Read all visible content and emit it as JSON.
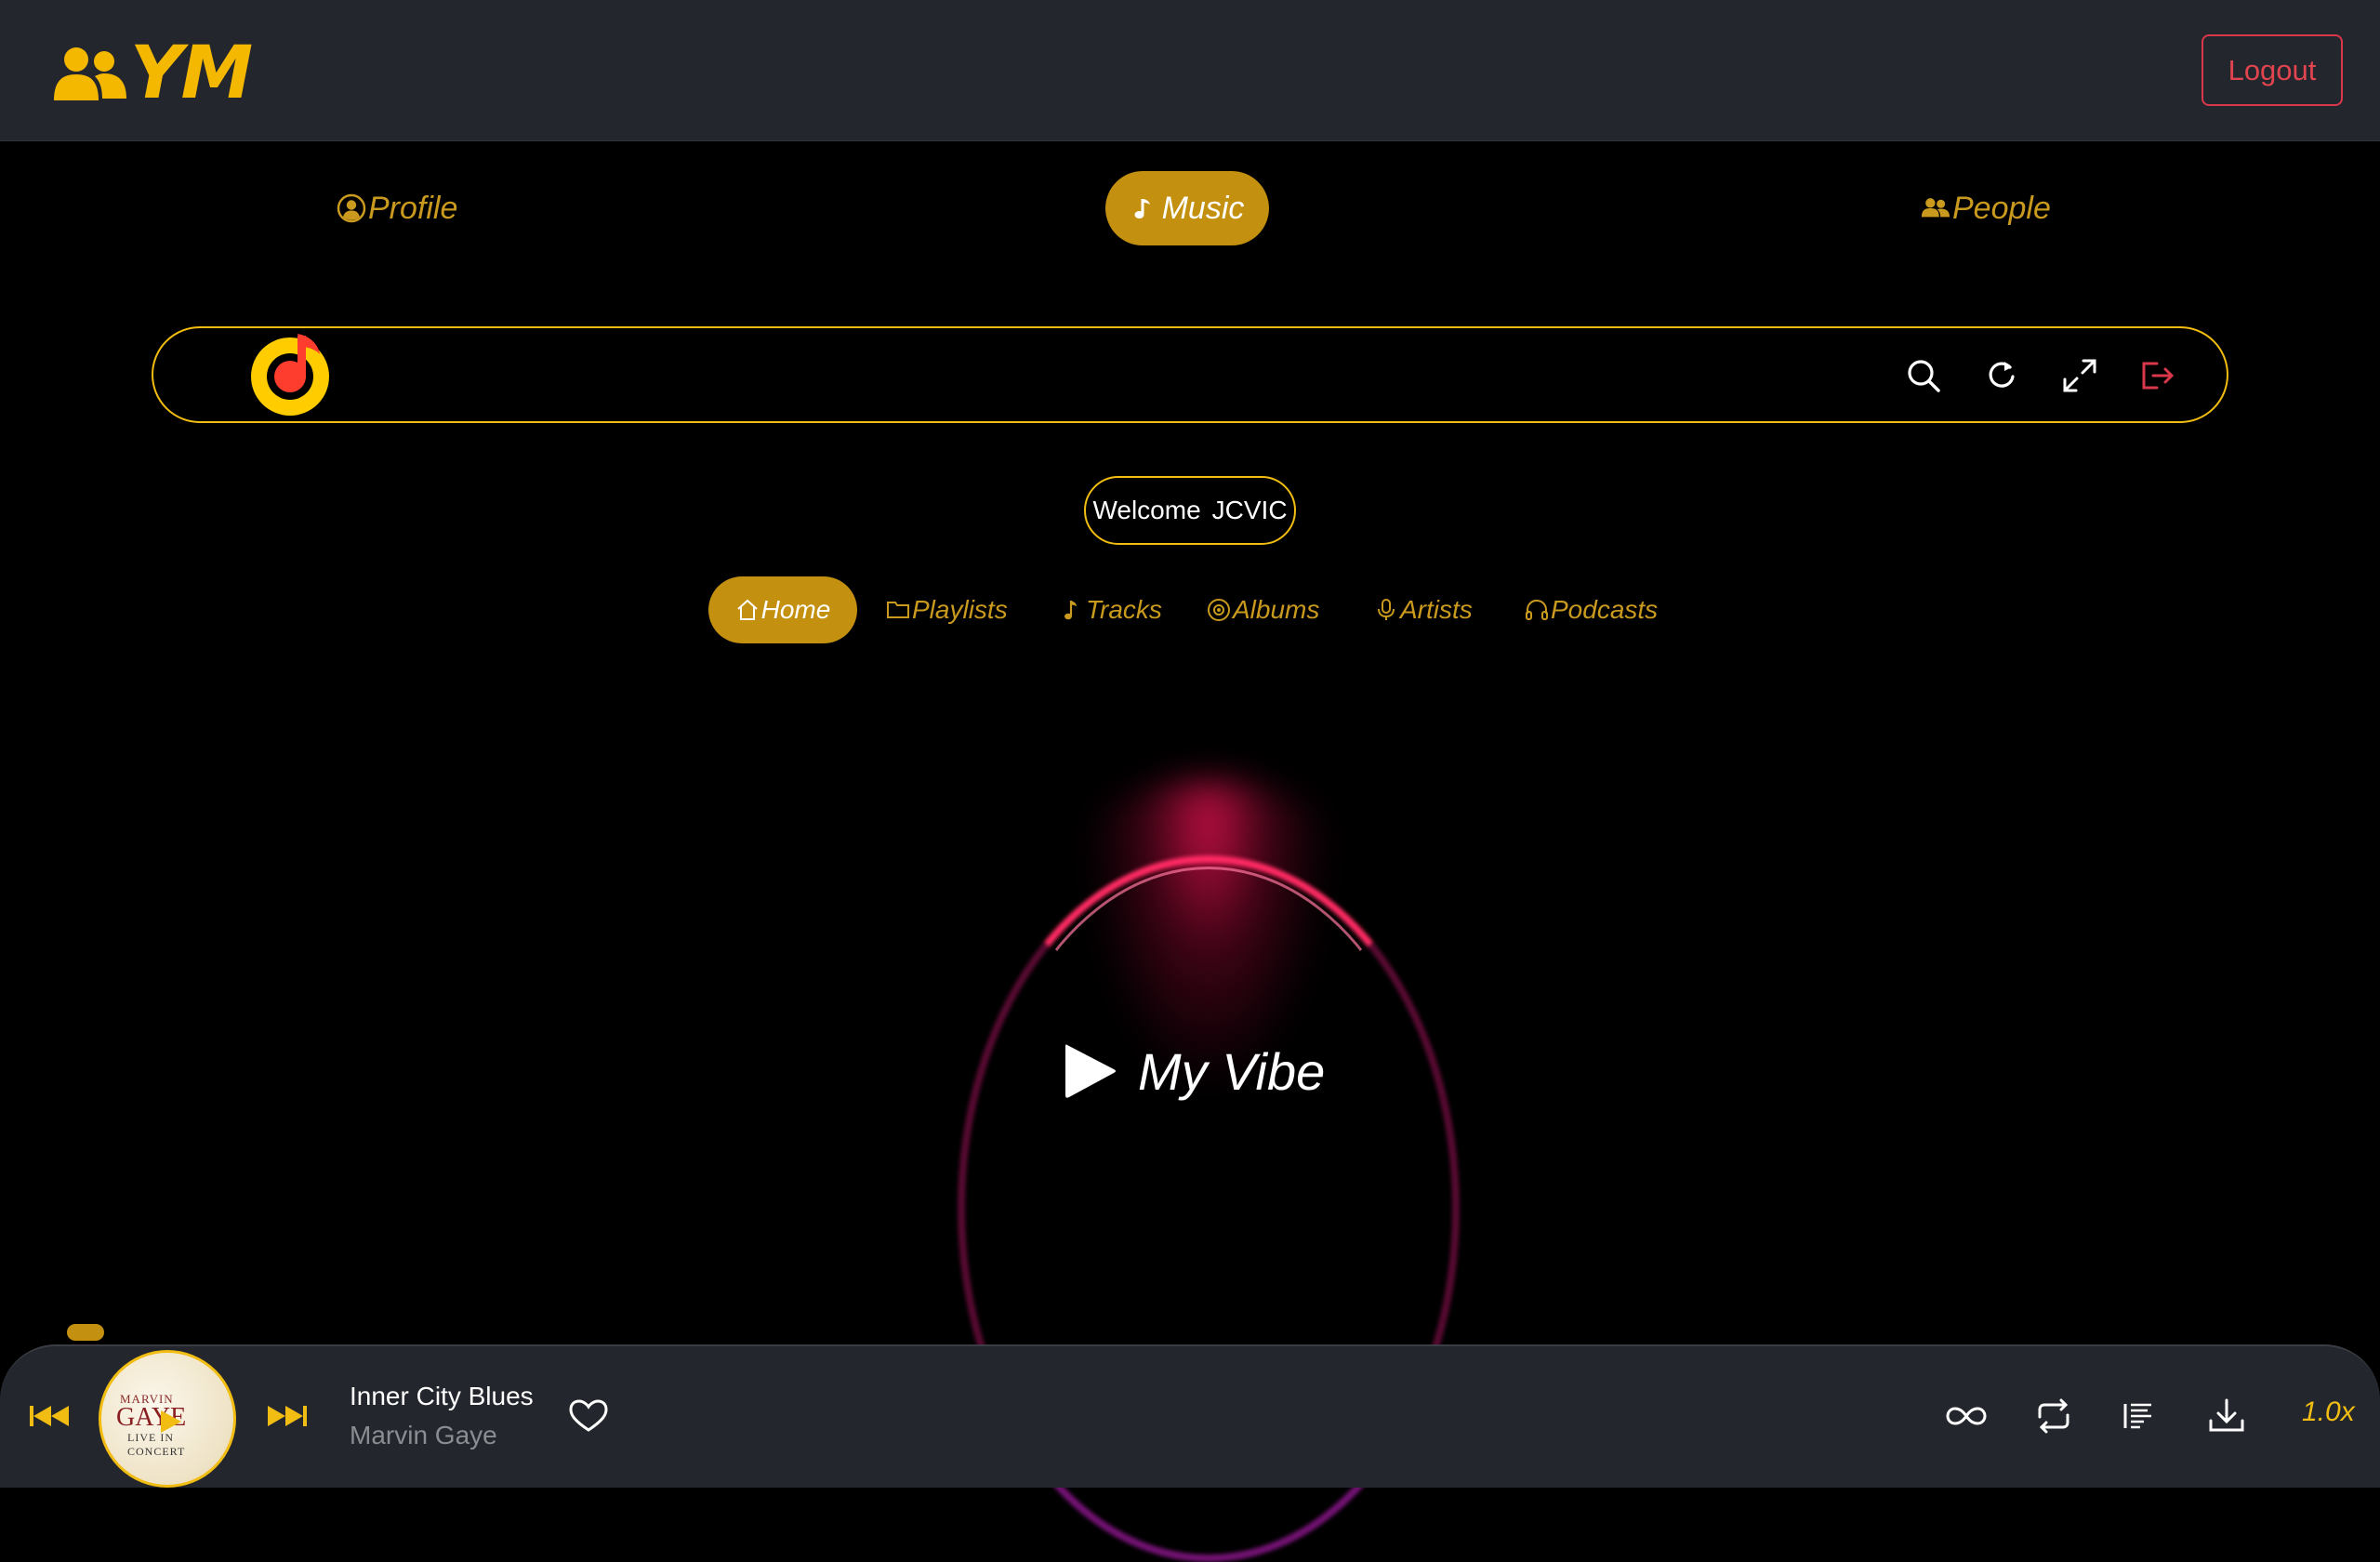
{
  "header": {
    "logo_text": "YM",
    "logout_label": "Logout"
  },
  "main_tabs": [
    {
      "label": "Profile",
      "icon": "user-circle-icon",
      "active": false
    },
    {
      "label": "Music",
      "icon": "music-note-icon",
      "active": true
    },
    {
      "label": "People",
      "icon": "people-icon",
      "active": false
    }
  ],
  "search_bar": {
    "logo": "yandex-music-logo",
    "actions": [
      "search-icon",
      "refresh-icon",
      "fullscreen-icon",
      "exit-icon"
    ]
  },
  "welcome": {
    "greeting": "Welcome",
    "username": "JCVIC"
  },
  "sub_nav": [
    {
      "label": "Home",
      "icon": "home-icon",
      "active": true
    },
    {
      "label": "Playlists",
      "icon": "folder-icon",
      "active": false
    },
    {
      "label": "Tracks",
      "icon": "music-note-icon",
      "active": false
    },
    {
      "label": "Albums",
      "icon": "disc-icon",
      "active": false
    },
    {
      "label": "Artists",
      "icon": "microphone-icon",
      "active": false
    },
    {
      "label": "Podcasts",
      "icon": "headphones-icon",
      "active": false
    }
  ],
  "vibe": {
    "label": "My Vibe"
  },
  "player": {
    "cover": {
      "line1": "MARVIN",
      "line2": "GAYE",
      "line3": "LIVE IN CONCERT"
    },
    "track_title": "Inner City Blues",
    "track_artist": "Marvin Gaye",
    "speed": "1.0x"
  },
  "colors": {
    "accent": "#f2bd12",
    "active_tab": "#c4900f",
    "logout": "#d9374a",
    "header_bg": "#23262c"
  }
}
